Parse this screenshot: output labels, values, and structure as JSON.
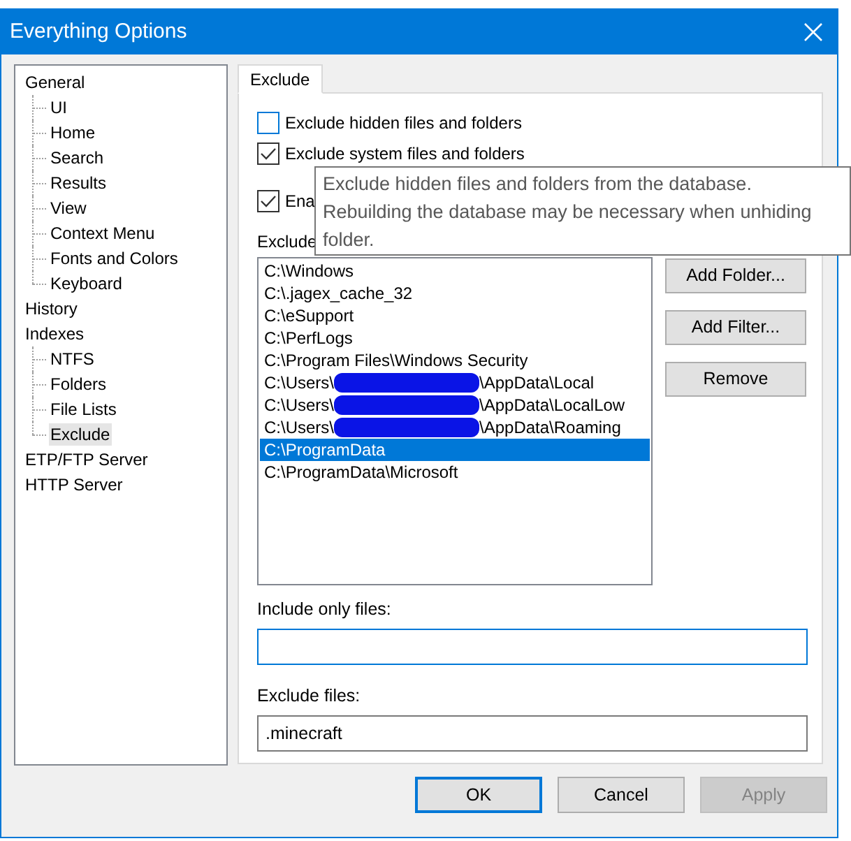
{
  "window": {
    "title": "Everything Options"
  },
  "tree": [
    {
      "label": "General",
      "selected": false,
      "children": [
        {
          "label": "UI",
          "selected": false
        },
        {
          "label": "Home",
          "selected": false
        },
        {
          "label": "Search",
          "selected": false
        },
        {
          "label": "Results",
          "selected": false
        },
        {
          "label": "View",
          "selected": false
        },
        {
          "label": "Context Menu",
          "selected": false
        },
        {
          "label": "Fonts and Colors",
          "selected": false
        },
        {
          "label": "Keyboard",
          "selected": false
        }
      ]
    },
    {
      "label": "History",
      "selected": false
    },
    {
      "label": "Indexes",
      "selected": false,
      "children": [
        {
          "label": "NTFS",
          "selected": false
        },
        {
          "label": "Folders",
          "selected": false
        },
        {
          "label": "File Lists",
          "selected": false
        },
        {
          "label": "Exclude",
          "selected": true
        }
      ]
    },
    {
      "label": "ETP/FTP Server",
      "selected": false
    },
    {
      "label": "HTTP Server",
      "selected": false
    }
  ],
  "tabs": [
    {
      "label": "Exclude",
      "selected": true
    }
  ],
  "checkboxes": [
    {
      "label": "Exclude hidden files and folders",
      "checked": false
    },
    {
      "label": "Exclude system files and folders",
      "checked": true
    },
    {
      "label": "Ena",
      "checked": true
    }
  ],
  "folders_label": "Exclude",
  "folders": [
    {
      "kind": "plain",
      "text": "C:\\Windows",
      "selected": false
    },
    {
      "kind": "plain",
      "text": "C:\\.jagex_cache_32",
      "selected": false
    },
    {
      "kind": "plain",
      "text": "C:\\eSupport",
      "selected": false
    },
    {
      "kind": "plain",
      "text": "C:\\PerfLogs",
      "selected": false
    },
    {
      "kind": "plain",
      "text": "C:\\Program Files\\Windows Security",
      "selected": false
    },
    {
      "kind": "redacted",
      "before": "C:\\Users\\",
      "after": "\\AppData\\Local",
      "selected": false
    },
    {
      "kind": "redacted",
      "before": "C:\\Users\\",
      "after": "\\AppData\\LocalLow",
      "selected": false
    },
    {
      "kind": "redacted",
      "before": "C:\\Users\\",
      "after": "\\AppData\\Roaming",
      "selected": false
    },
    {
      "kind": "plain",
      "text": "C:\\ProgramData",
      "selected": true
    },
    {
      "kind": "plain",
      "text": "C:\\ProgramData\\Microsoft",
      "selected": false
    }
  ],
  "side_buttons": [
    "Add Folder...",
    "Add Filter...",
    "Remove"
  ],
  "include_only": {
    "label": "Include only files:",
    "focused": true
  },
  "exclude_files": {
    "label": "Exclude files:",
    "value": ".minecraft",
    "focused": false
  },
  "tooltip": [
    "Exclude hidden files and folders from the database.",
    "Rebuilding the database may be necessary when unhiding",
    "folder."
  ],
  "buttons": [
    {
      "label": "OK",
      "kind": "default",
      "disabled": false
    },
    {
      "label": "Cancel",
      "kind": "normal",
      "disabled": false
    },
    {
      "label": "Apply",
      "kind": "normal",
      "disabled": true
    }
  ]
}
